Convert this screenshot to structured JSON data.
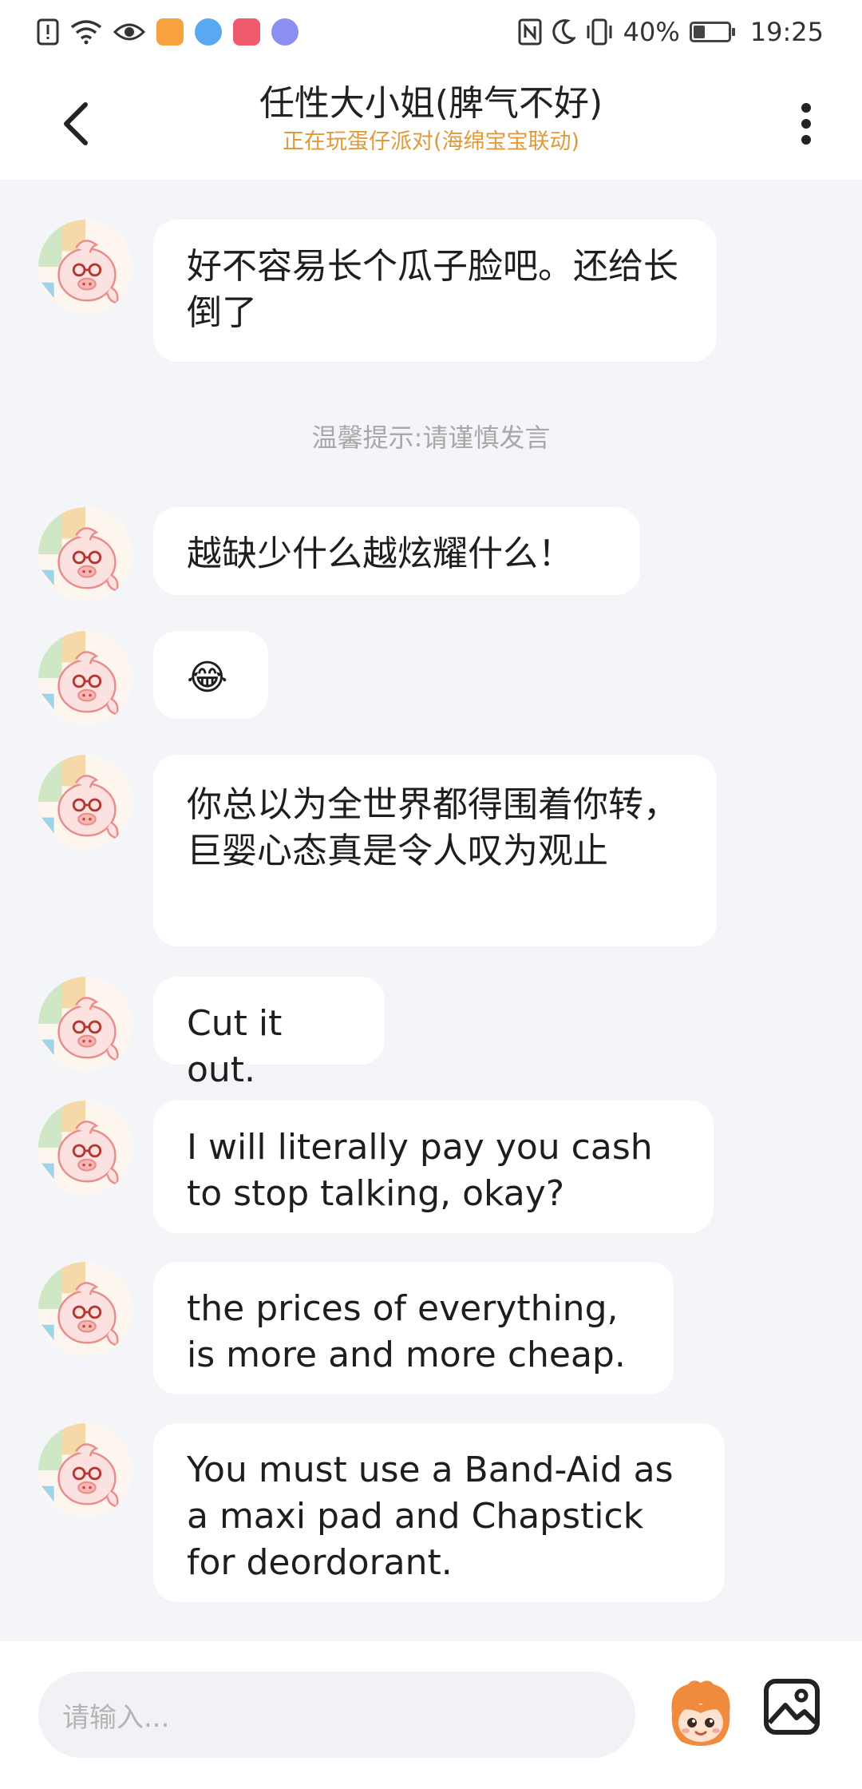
{
  "status_bar": {
    "battery_text": "40%",
    "battery_level": 0.4,
    "time": "19:25",
    "icons": [
      "alert-icon",
      "wifi-icon",
      "eye-icon",
      "video-app-icon",
      "browser-app-icon",
      "huawei-app-icon",
      "music-app-icon",
      "nfc-icon",
      "moon-icon",
      "vibrate-icon"
    ]
  },
  "header": {
    "title": "任性大小姐(脾气不好)",
    "subtitle": "正在玩蛋仔派对(海绵宝宝联动)",
    "back_icon": "chevron-left-icon",
    "more_icon": "more-vertical-icon"
  },
  "notice": "温馨提示:请谨慎发言",
  "messages": [
    {
      "text": "好不容易长个瓜子脸吧。还给长倒了"
    },
    {
      "text": "越缺少什么越炫耀什么！"
    },
    {
      "text": "😂"
    },
    {
      "text": "你总以为全世界都得围着你转，巨婴心态真是令人叹为观止"
    },
    {
      "text": "Cut it out."
    },
    {
      "text": "I will literally pay you cash to stop talking, okay?"
    },
    {
      "text": "the prices of everything, is more and more cheap."
    },
    {
      "text": "You must use a Band-Aid as a maxi pad and Chapstick for deordorant."
    }
  ],
  "input": {
    "placeholder": "请输入..."
  },
  "colors": {
    "accent_orange": "#e09a3a",
    "background": "#f4f5f9",
    "bubble": "#ffffff"
  }
}
